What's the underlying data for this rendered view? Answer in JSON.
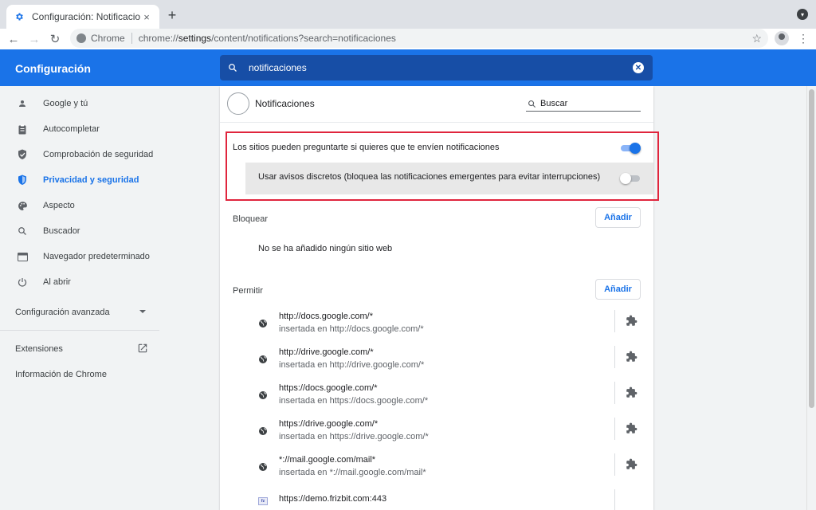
{
  "tab": {
    "title": "Configuración: Notificaciones",
    "close": "×",
    "new_tab": "+"
  },
  "toolbar": {
    "site_label": "Chrome",
    "url_host": "chrome://",
    "url_bold": "settings",
    "url_rest": "/content/notifications?search=notificaciones"
  },
  "header": {
    "title": "Configuración",
    "search_value": "notificaciones"
  },
  "sidebar": {
    "items": [
      {
        "label": "Google y tú",
        "icon": "person-icon"
      },
      {
        "label": "Autocompletar",
        "icon": "clipboard-icon"
      },
      {
        "label": "Comprobación de seguridad",
        "icon": "shield-check-icon"
      },
      {
        "label": "Privacidad y seguridad",
        "icon": "shield-icon",
        "active": true
      },
      {
        "label": "Aspecto",
        "icon": "palette-icon"
      },
      {
        "label": "Buscador",
        "icon": "search-icon"
      },
      {
        "label": "Navegador predeterminado",
        "icon": "browser-icon"
      },
      {
        "label": "Al abrir",
        "icon": "power-icon"
      }
    ],
    "advanced": "Configuración avanzada",
    "extensions": "Extensiones",
    "about": "Información de Chrome"
  },
  "page": {
    "title": "Notificaciones",
    "search_placeholder": "Buscar",
    "ask_label": "Los sitios pueden preguntarte si quieres que te envíen notificaciones",
    "ask_enabled": true,
    "quiet_label": "Usar avisos discretos (bloquea las notificaciones emergentes para evitar interrupciones)",
    "quiet_enabled": false,
    "block": {
      "label": "Bloquear",
      "add": "Añadir",
      "empty": "No se ha añadido ningún sitio web"
    },
    "allow": {
      "label": "Permitir",
      "add": "Añadir",
      "sites": [
        {
          "origin": "http://docs.google.com/*",
          "embedded": "insertada en http://docs.google.com/*"
        },
        {
          "origin": "http://drive.google.com/*",
          "embedded": "insertada en http://drive.google.com/*"
        },
        {
          "origin": "https://docs.google.com/*",
          "embedded": "insertada en https://docs.google.com/*"
        },
        {
          "origin": "https://drive.google.com/*",
          "embedded": "insertada en https://drive.google.com/*"
        },
        {
          "origin": "*://mail.google.com/mail*",
          "embedded": "insertada en *://mail.google.com/mail*"
        },
        {
          "origin": "https://demo.frizbit.com:443",
          "embedded": ""
        }
      ]
    }
  },
  "colors": {
    "accent": "#1a73e8",
    "highlight_border": "#e0253d",
    "header_search": "#174ea6"
  }
}
